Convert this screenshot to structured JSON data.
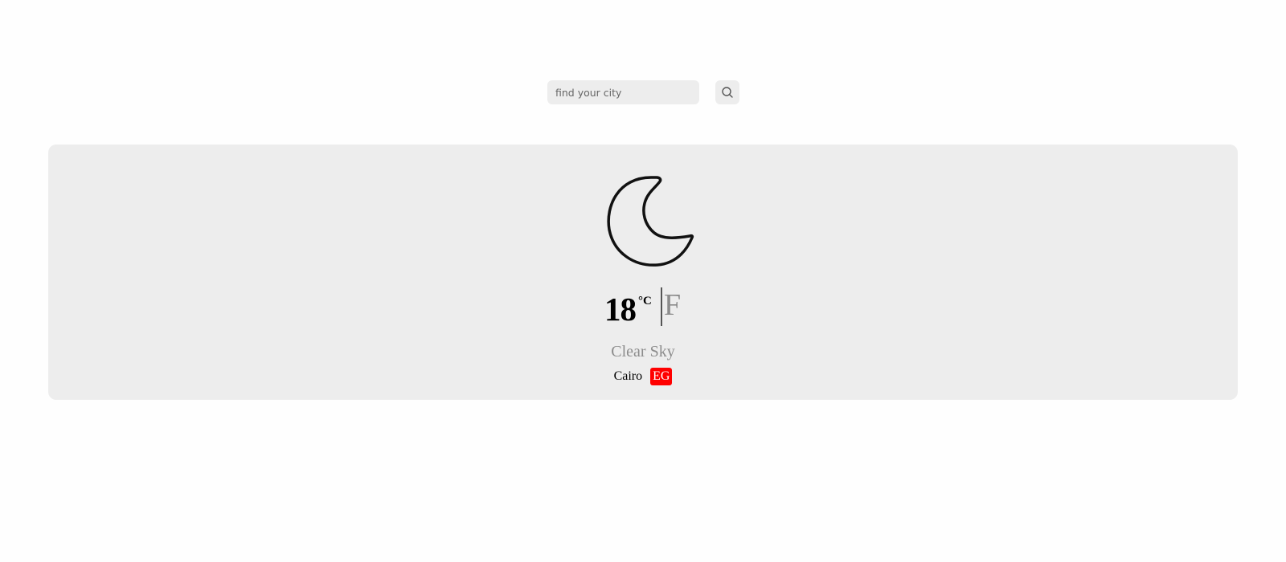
{
  "search": {
    "placeholder": "find your city",
    "value": "",
    "button_icon": "search-icon"
  },
  "weather": {
    "icon": "crescent-moon-icon",
    "temperature": "18",
    "unit_celsius": "°C",
    "unit_fahrenheit": "F",
    "condition": "Clear Sky",
    "city": "Cairo",
    "country_code": "EG"
  },
  "colors": {
    "card_background": "#ededed",
    "country_badge": "#ff0000",
    "muted_text": "#8c8c8c"
  }
}
